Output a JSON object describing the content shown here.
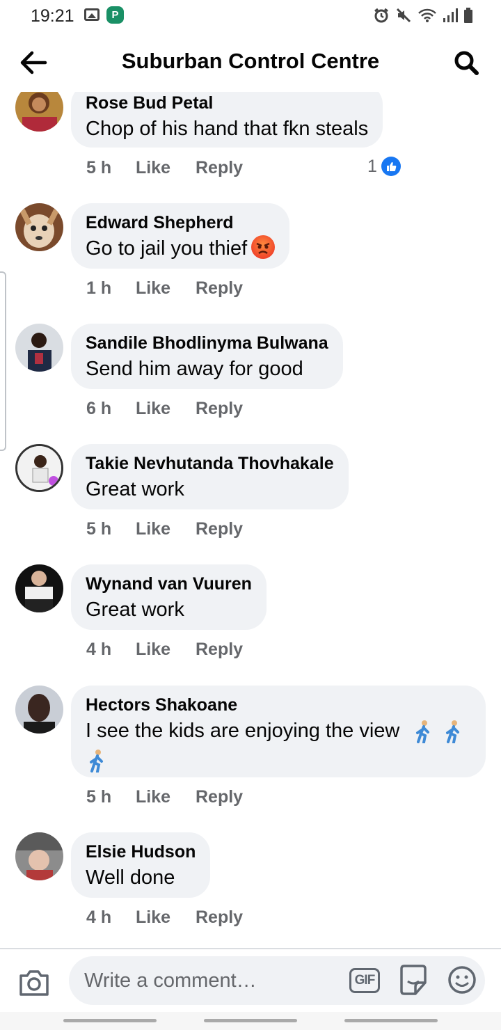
{
  "status_bar": {
    "time": "19:21",
    "icons": [
      "gallery-icon",
      "app-icon",
      "alarm-icon",
      "mute-icon",
      "wifi-icon",
      "signal-icon",
      "battery-icon"
    ]
  },
  "header": {
    "title": "Suburban Control Centre",
    "back_icon": "arrow-left-icon",
    "search_icon": "search-icon"
  },
  "comments": [
    {
      "name": "Rose Bud Petal",
      "text": "Chop of his hand that fkn steals",
      "time": "5 h",
      "like_label": "Like",
      "reply_label": "Reply",
      "reaction_count": "1"
    },
    {
      "name": "Edward Shepherd",
      "text": "Go to jail you thief",
      "emoji": "angry-face",
      "time": "1 h",
      "like_label": "Like",
      "reply_label": "Reply"
    },
    {
      "name": "Sandile Bhodlinyma Bulwana",
      "text": "Send him away for good",
      "time": "6 h",
      "like_label": "Like",
      "reply_label": "Reply"
    },
    {
      "name": "Takie Nevhutanda Thovhakale",
      "text": "Great work",
      "time": "5 h",
      "like_label": "Like",
      "reply_label": "Reply"
    },
    {
      "name": "Wynand van Vuuren",
      "text": "Great work",
      "time": "4 h",
      "like_label": "Like",
      "reply_label": "Reply"
    },
    {
      "name": "Hectors Shakoane",
      "text": "I see the kids are enjoying the view",
      "emoji": "person-walking x3",
      "time": "5 h",
      "like_label": "Like",
      "reply_label": "Reply"
    },
    {
      "name": "Elsie Hudson",
      "text": "Well done",
      "time": "4 h",
      "like_label": "Like",
      "reply_label": "Reply"
    }
  ],
  "composer": {
    "placeholder": "Write a comment…",
    "gif_label": "GIF"
  },
  "colors": {
    "bubble": "#f0f2f5",
    "meta_text": "#65676b",
    "like_blue": "#1877f2"
  }
}
